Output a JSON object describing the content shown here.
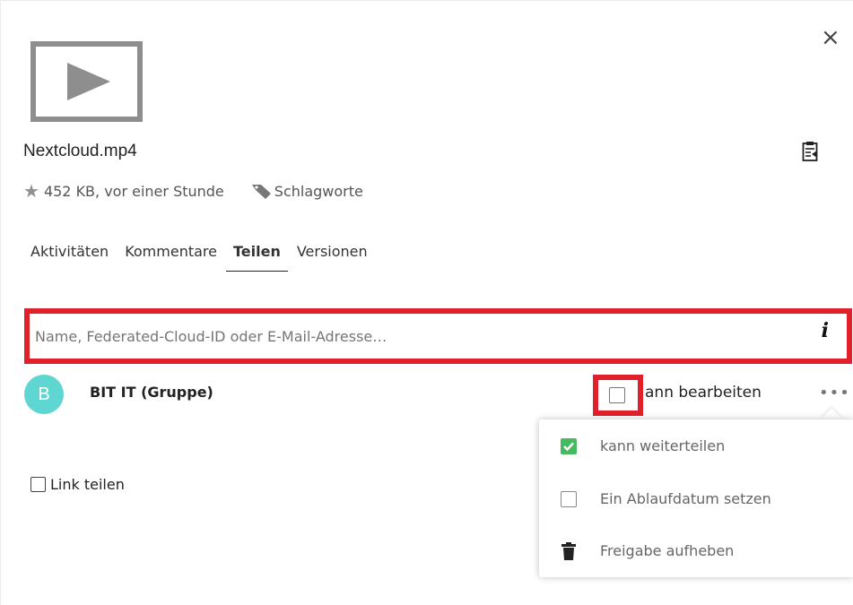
{
  "file": {
    "name": "Nextcloud.mp4",
    "size_time": "452 KB, vor einer Stunde",
    "tags_label": "Schlagworte"
  },
  "tabs": [
    {
      "label": "Aktivitäten"
    },
    {
      "label": "Kommentare"
    },
    {
      "label": "Teilen"
    },
    {
      "label": "Versionen"
    }
  ],
  "search": {
    "placeholder": "Name, Federated-Cloud-ID oder E-Mail-Adresse…",
    "info_glyph": "i"
  },
  "share": {
    "avatar_letter": "B",
    "name": "BIT IT (Gruppe)",
    "edit_label": "ann bearbeiten",
    "more_glyph": "•••"
  },
  "link_share_label": "Link teilen",
  "menu": {
    "items": [
      {
        "label": "kann weiterteilen",
        "checked": true
      },
      {
        "label": "Ein Ablaufdatum setzen",
        "checked": false
      },
      {
        "label": "Freigabe aufheben",
        "icon": "trash-icon"
      }
    ]
  },
  "close_glyph": "×",
  "colors": {
    "highlight": "#e0202a",
    "avatar": "#5fd6d2",
    "check_green": "#46ba61"
  }
}
